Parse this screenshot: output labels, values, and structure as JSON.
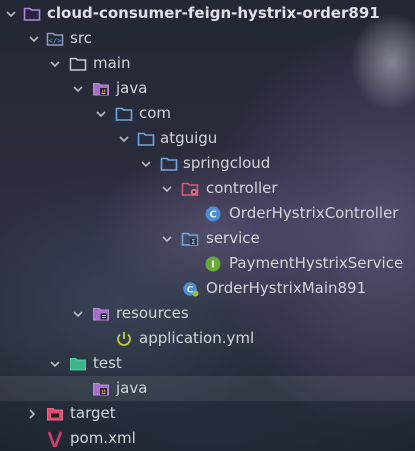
{
  "project": {
    "name": "cloud-consumer-feign-hystrix-order891"
  },
  "tree": {
    "src": "src",
    "main": "main",
    "java_main": "java",
    "com": "com",
    "atguigu": "atguigu",
    "springcloud": "springcloud",
    "controller": "controller",
    "order_controller": "OrderHystrixController",
    "service": "service",
    "payment_service": "PaymentHystrixService",
    "main_class": "OrderHystrixMain891",
    "resources": "resources",
    "application_yml": "application.yml",
    "test": "test",
    "java_test": "java",
    "target": "target",
    "pom": "pom.xml"
  },
  "icons": {
    "folder": "folder-icon",
    "source_root": "source-folder-icon",
    "java_root": "java-source-root-icon",
    "package": "package-icon",
    "controller_pkg": "controller-package-icon",
    "service_pkg": "service-package-icon",
    "class": "class-icon",
    "interface": "interface-icon",
    "main_class": "spring-boot-main-class-icon",
    "resources": "resources-folder-icon",
    "yml": "spring-yml-icon",
    "test_folder": "test-folder-icon",
    "target": "excluded-folder-icon",
    "maven": "maven-icon"
  },
  "colors": {
    "text": "#d2d5da",
    "folder_blue": "#6fa9dc",
    "folder_grey": "#c7ccd3",
    "java_purple": "#a571c8",
    "class_blue": "#4b8ed6",
    "interface_green": "#68a83c",
    "spring_green": "#9ac02a",
    "test_green": "#3fb58b",
    "target_red": "#dd4b6f",
    "maven_pink": "#d43c6d"
  }
}
